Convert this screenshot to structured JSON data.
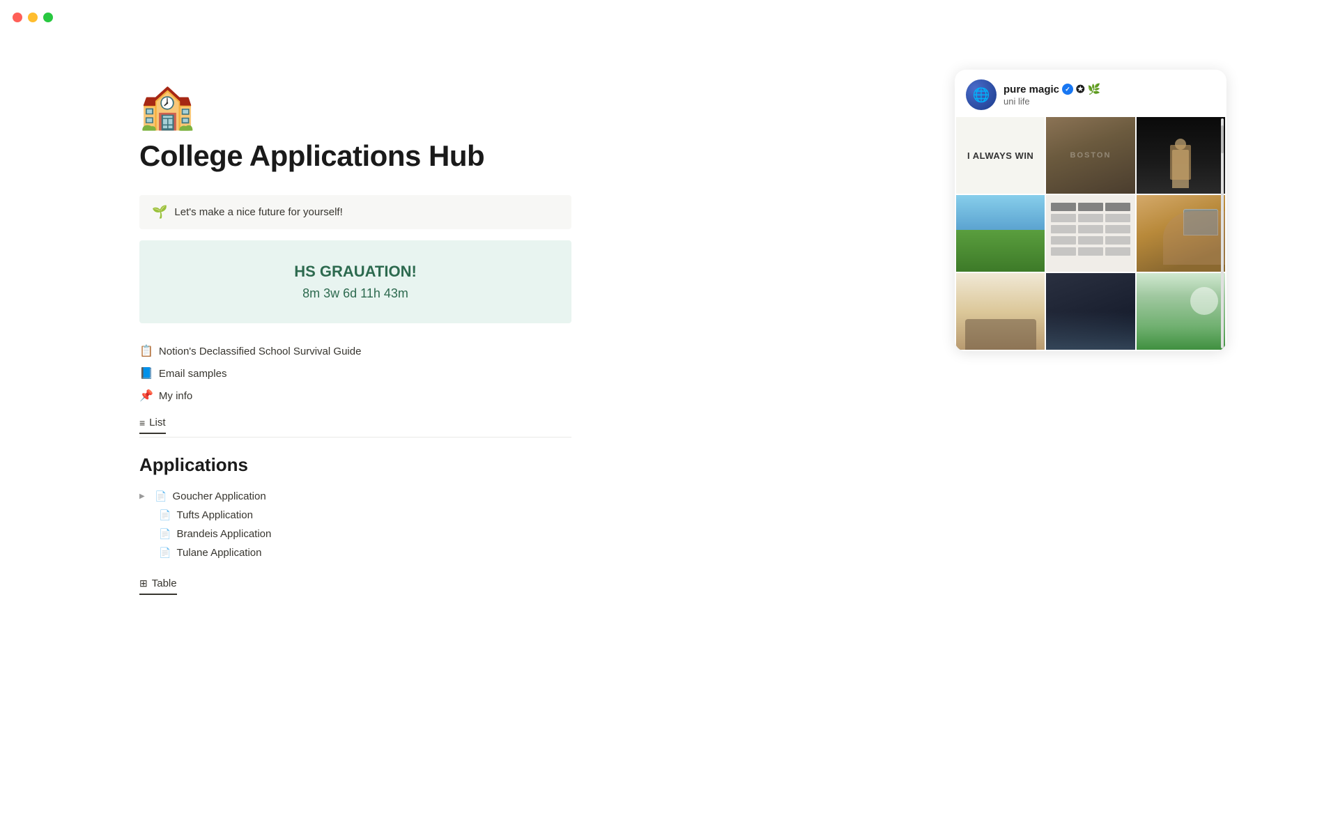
{
  "window": {
    "traffic_lights": {
      "red_label": "close",
      "yellow_label": "minimize",
      "green_label": "maximize"
    }
  },
  "page": {
    "icon": "🏫",
    "title": "College Applications Hub",
    "callout": {
      "icon": "🌱",
      "text": "Let's make a nice future for yourself!"
    },
    "countdown": {
      "title": "HS GRAUATION!",
      "time": "8m 3w 6d 11h 43m"
    },
    "links": [
      {
        "icon": "📋",
        "text": "Notion's Declassified School Survival Guide"
      },
      {
        "icon": "📘",
        "text": "Email samples"
      },
      {
        "icon": "📌",
        "text": "My info"
      }
    ],
    "view_list": {
      "icon": "≡",
      "label": "List"
    },
    "applications_heading": "Applications",
    "applications": [
      {
        "name": "Goucher Application",
        "has_toggle": true,
        "indented": false
      },
      {
        "name": "Tufts Application",
        "has_toggle": false,
        "indented": true
      },
      {
        "name": "Brandeis Application",
        "has_toggle": false,
        "indented": true
      },
      {
        "name": "Tulane Application",
        "has_toggle": false,
        "indented": true
      }
    ],
    "view_table": {
      "icon": "⊞",
      "label": "Table"
    }
  },
  "social_card": {
    "account_name": "pure magic",
    "verified": true,
    "emojis": "✪ 🌿",
    "subtitle": "uni life",
    "text_cell": "I ALWAYS WIN",
    "photos": [
      "text",
      "boston-hoodie",
      "speaker-dark",
      "campus-green",
      "table-sheet",
      "laptop-study",
      "cafe-scene",
      "group-study",
      "garden-work"
    ]
  }
}
